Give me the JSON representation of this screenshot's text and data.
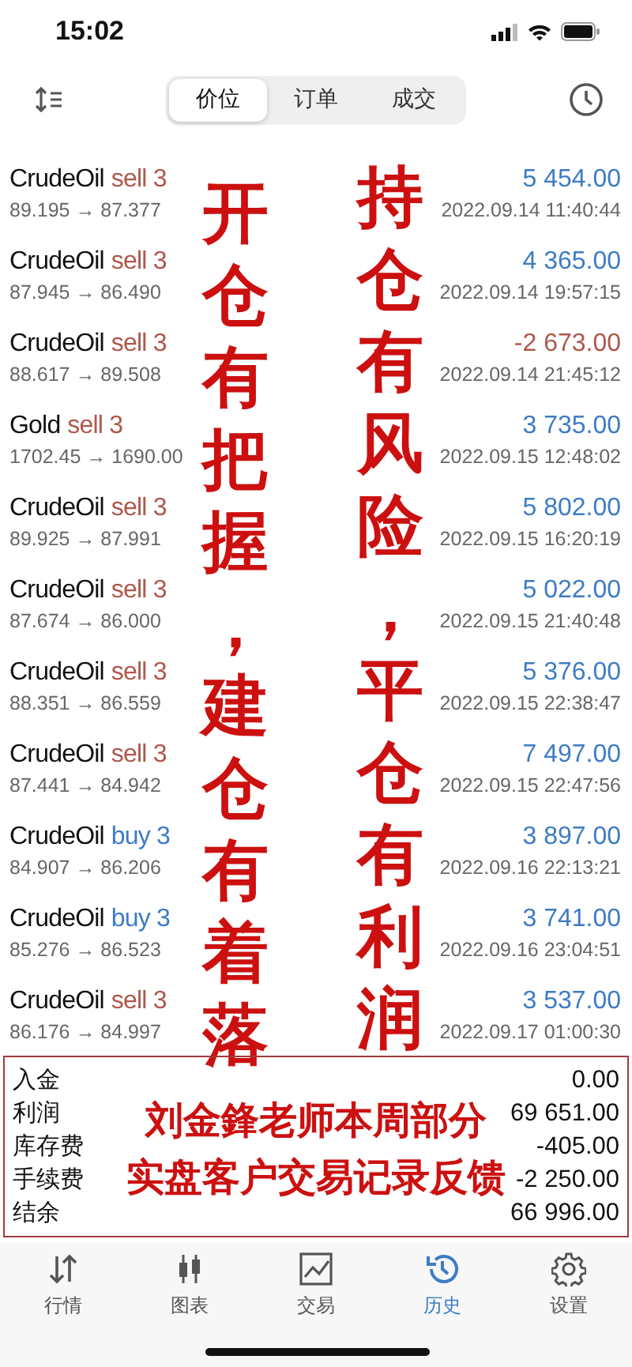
{
  "status_bar": {
    "time": "15:02"
  },
  "toolbar": {
    "segments": [
      {
        "label": "价位",
        "selected": true
      },
      {
        "label": "订单",
        "selected": false
      },
      {
        "label": "成交",
        "selected": false
      }
    ]
  },
  "trades": [
    {
      "symbol": "CrudeOil",
      "side": "sell 3",
      "kind": "sell",
      "prices": "89.195 → 87.377",
      "profit": "5 454.00",
      "negative": false,
      "time": "2022.09.14 11:40:44"
    },
    {
      "symbol": "CrudeOil",
      "side": "sell 3",
      "kind": "sell",
      "prices": "87.945 → 86.490",
      "profit": "4 365.00",
      "negative": false,
      "time": "2022.09.14 19:57:15"
    },
    {
      "symbol": "CrudeOil",
      "side": "sell 3",
      "kind": "sell",
      "prices": "88.617 → 89.508",
      "profit": "-2 673.00",
      "negative": true,
      "time": "2022.09.14 21:45:12"
    },
    {
      "symbol": "Gold",
      "side": "sell 3",
      "kind": "sell",
      "prices": "1702.45 → 1690.00",
      "profit": "3 735.00",
      "negative": false,
      "time": "2022.09.15 12:48:02"
    },
    {
      "symbol": "CrudeOil",
      "side": "sell 3",
      "kind": "sell",
      "prices": "89.925 → 87.991",
      "profit": "5 802.00",
      "negative": false,
      "time": "2022.09.15 16:20:19"
    },
    {
      "symbol": "CrudeOil",
      "side": "sell 3",
      "kind": "sell",
      "prices": "87.674 → 86.000",
      "profit": "5 022.00",
      "negative": false,
      "time": "2022.09.15 21:40:48"
    },
    {
      "symbol": "CrudeOil",
      "side": "sell 3",
      "kind": "sell",
      "prices": "88.351 → 86.559",
      "profit": "5 376.00",
      "negative": false,
      "time": "2022.09.15 22:38:47"
    },
    {
      "symbol": "CrudeOil",
      "side": "sell 3",
      "kind": "sell",
      "prices": "87.441 → 84.942",
      "profit": "7 497.00",
      "negative": false,
      "time": "2022.09.15 22:47:56"
    },
    {
      "symbol": "CrudeOil",
      "side": "buy 3",
      "kind": "buy",
      "prices": "84.907 → 86.206",
      "profit": "3 897.00",
      "negative": false,
      "time": "2022.09.16 22:13:21"
    },
    {
      "symbol": "CrudeOil",
      "side": "buy 3",
      "kind": "buy",
      "prices": "85.276 → 86.523",
      "profit": "3 741.00",
      "negative": false,
      "time": "2022.09.16 23:04:51"
    },
    {
      "symbol": "CrudeOil",
      "side": "sell 3",
      "kind": "sell",
      "prices": "86.176 → 84.997",
      "profit": "3 537.00",
      "negative": false,
      "time": "2022.09.17 01:00:30"
    }
  ],
  "calligraphy": [
    "开仓有把握，建仓有着落",
    "持仓有风险，平仓有利润"
  ],
  "summary": [
    {
      "label": "入金",
      "value": "0.00"
    },
    {
      "label": "利润",
      "value": "69 651.00"
    },
    {
      "label": "库存费",
      "value": "-405.00"
    },
    {
      "label": "手续费",
      "value": "-2 250.00"
    },
    {
      "label": "结余",
      "value": "66 996.00"
    }
  ],
  "summary_caption": [
    "刘金鋒老师本周部分",
    "实盘客户交易记录反馈"
  ],
  "tab_bar": {
    "tabs": [
      {
        "label": "行情",
        "selected": false
      },
      {
        "label": "图表",
        "selected": false
      },
      {
        "label": "交易",
        "selected": false
      },
      {
        "label": "历史",
        "selected": true
      },
      {
        "label": "设置",
        "selected": false
      }
    ]
  }
}
